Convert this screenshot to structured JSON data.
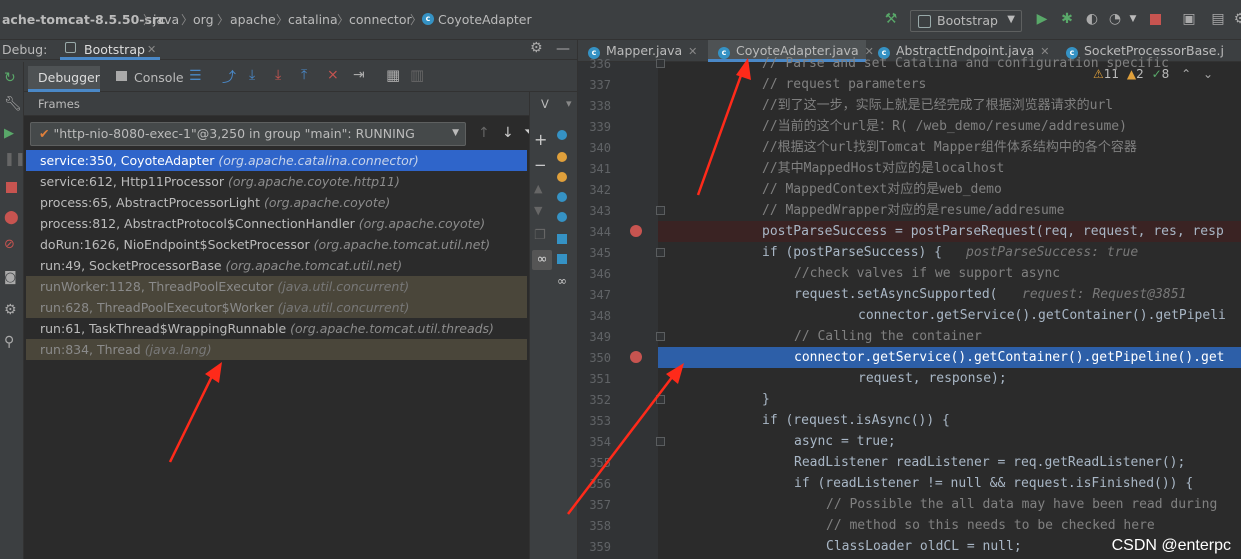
{
  "nav": {
    "crumbs": [
      "ache-tomcat-8.5.50-src",
      "java",
      "org",
      "apache",
      "catalina",
      "connector",
      "CoyoteAdapter"
    ],
    "run_config": "Bootstrap"
  },
  "debug_panel": {
    "title": "Debug:",
    "session_tab": "Bootstrap",
    "tabs": [
      "Debugger",
      "Console"
    ],
    "frames_label": "Frames",
    "vars_label": "V",
    "thread": "\"http-nio-8080-exec-1\"@3,250 in group \"main\": RUNNING",
    "frames": [
      {
        "method": "service:350, CoyoteAdapter",
        "pkg": "(org.apache.catalina.connector)",
        "kind": "selected"
      },
      {
        "method": "service:612, Http11Processor",
        "pkg": "(org.apache.coyote.http11)",
        "kind": "normal"
      },
      {
        "method": "process:65, AbstractProcessorLight",
        "pkg": "(org.apache.coyote)",
        "kind": "normal"
      },
      {
        "method": "process:812, AbstractProtocol$ConnectionHandler",
        "pkg": "(org.apache.coyote)",
        "kind": "normal"
      },
      {
        "method": "doRun:1626, NioEndpoint$SocketProcessor",
        "pkg": "(org.apache.tomcat.util.net)",
        "kind": "normal"
      },
      {
        "method": "run:49, SocketProcessorBase",
        "pkg": "(org.apache.tomcat.util.net)",
        "kind": "normal"
      },
      {
        "method": "runWorker:1128, ThreadPoolExecutor",
        "pkg": "(java.util.concurrent)",
        "kind": "library"
      },
      {
        "method": "run:628, ThreadPoolExecutor$Worker",
        "pkg": "(java.util.concurrent)",
        "kind": "library"
      },
      {
        "method": "run:61, TaskThread$WrappingRunnable",
        "pkg": "(org.apache.tomcat.util.threads)",
        "kind": "normal"
      },
      {
        "method": "run:834, Thread",
        "pkg": "(java.lang)",
        "kind": "library"
      }
    ]
  },
  "editor": {
    "tabs": [
      "Mapper.java",
      "CoyoteAdapter.java",
      "AbstractEndpoint.java",
      "SocketProcessorBase.j"
    ],
    "active_tab": "CoyoteAdapter.java",
    "inspections": {
      "warnings": "11",
      "weak": "2",
      "typos": "8"
    },
    "line_numbers": [
      "336",
      "337",
      "338",
      "339",
      "340",
      "341",
      "342",
      "343",
      "344",
      "345",
      "346",
      "347",
      "348",
      "349",
      "350",
      "351",
      "352",
      "353",
      "354",
      "355",
      "356",
      "357",
      "358",
      "359"
    ],
    "code_lines": [
      "// Parse and set Catalina and configuration specific",
      "// request parameters",
      "//到了这一步，实际上就是已经完成了根据浏览器请求的url",
      "//当前的这个url是：R( /web_demo/resume/addresume)",
      "//根据这个url找到Tomcat Mapper组件体系结构中的各个容器",
      "//其中MappedHost对应的是localhost",
      "// MappedContext对应的是web_demo",
      "// MappedWrapper对应的是resume/addresume",
      "postParseSuccess = postParseRequest(req, request, res, resp",
      "if (postParseSuccess) {",
      "//check valves if we support async",
      "request.setAsyncSupported(",
      "connector.getService().getContainer().getPipeli",
      "// Calling the container",
      "connector.getService().getContainer().getPipeline().get",
      "request, response);",
      "}",
      "if (request.isAsync()) {",
      "async = true;",
      "ReadListener readListener = req.getReadListener();",
      "if (readListener != null && request.isFinished()) {",
      "// Possible the all data may have been read during",
      "// method so this needs to be checked here",
      "ClassLoader oldCL = null;"
    ],
    "hints": {
      "line345": "postParseSuccess: true",
      "line347": "request: Request@3851"
    }
  },
  "watermark": "CSDN @enterpc",
  "colors": {
    "selection": "#2f65ca",
    "breakpoint": "#c75450",
    "arrow": "#ff2a1a"
  }
}
